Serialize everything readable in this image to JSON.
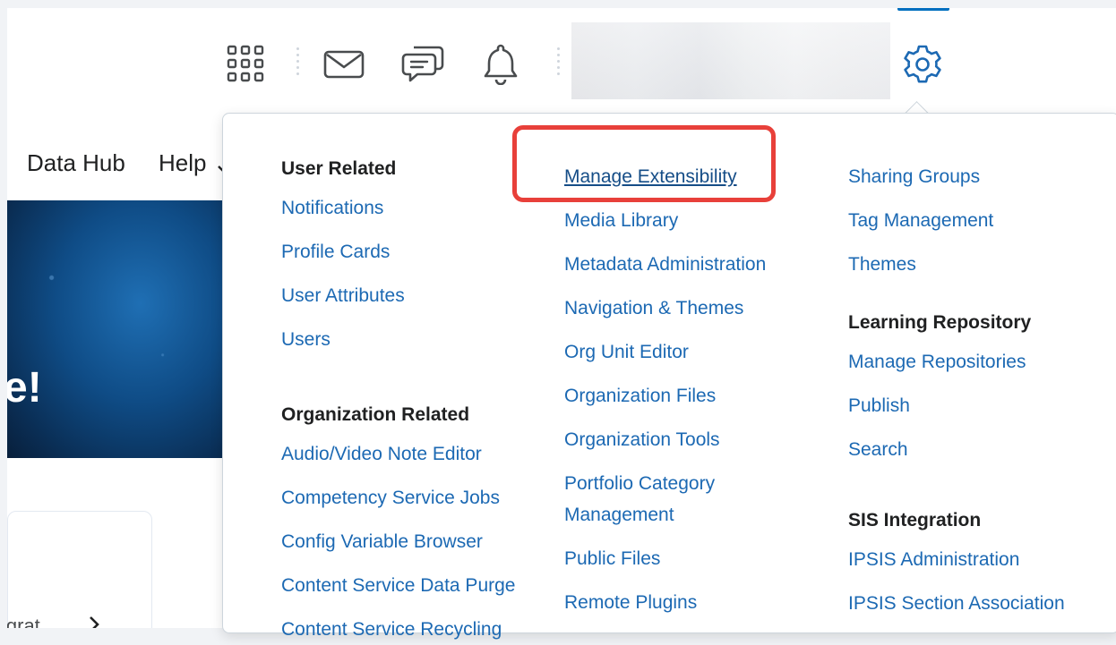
{
  "nav": {
    "data_hub": "Data Hub",
    "help": "Help"
  },
  "hero": {
    "text": "e!"
  },
  "card": {
    "partial_text": "igrat..."
  },
  "admin_menu": {
    "col1": {
      "user_related": {
        "heading": "User Related",
        "items": [
          "Notifications",
          "Profile Cards",
          "User Attributes",
          "Users"
        ]
      },
      "organization_related": {
        "heading": "Organization Related",
        "items": [
          "Audio/Video Note Editor",
          "Competency Service Jobs",
          "Config Variable Browser",
          "Content Service Data Purge",
          "Content Service Recycling"
        ]
      }
    },
    "col2": {
      "items": [
        "Manage Extensibility",
        "Media Library",
        "Metadata Administration",
        "Navigation & Themes",
        "Org Unit Editor",
        "Organization Files",
        "Organization Tools",
        "Portfolio Category Management",
        "Public Files",
        "Remote Plugins"
      ]
    },
    "col3": {
      "items_top": [
        "Sharing Groups",
        "Tag Management",
        "Themes"
      ],
      "learning_repository": {
        "heading": "Learning Repository",
        "items": [
          "Manage Repositories",
          "Publish",
          "Search"
        ]
      },
      "sis_integration": {
        "heading": "SIS Integration",
        "items": [
          "IPSIS Administration",
          "IPSIS Section Association"
        ]
      }
    }
  },
  "colors": {
    "link": "#1c69b3",
    "highlight": "#e8403a",
    "active_tab": "#006fbf"
  }
}
